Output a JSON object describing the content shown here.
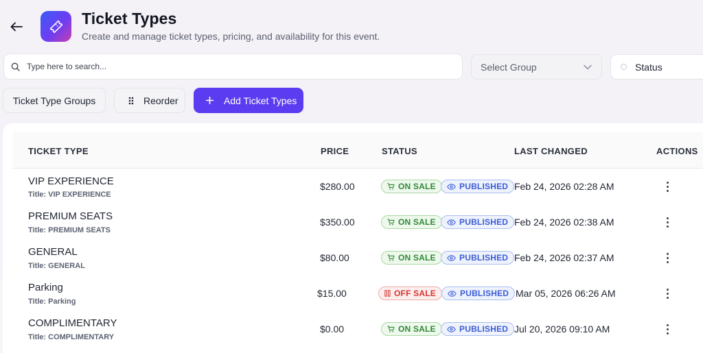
{
  "header": {
    "title": "Ticket Types",
    "subtitle": "Create and manage ticket types, pricing, and availability for this event."
  },
  "toolbar": {
    "search_placeholder": "Type here to search...",
    "group_select_label": "Select Group",
    "status_filter_label": "Status",
    "groups_button": "Ticket Type Groups",
    "reorder_button": "Reorder",
    "add_button": "Add Ticket Types"
  },
  "table": {
    "columns": [
      "TICKET TYPE",
      "PRICE",
      "STATUS",
      "LAST CHANGED",
      "ACTIONS"
    ],
    "rows": [
      {
        "name": "VIP EXPERIENCE",
        "title": "Title: VIP EXPERIENCE",
        "price": "$280.00",
        "sale": "ON SALE",
        "publish": "PUBLISHED",
        "changed": "Feb 24, 2026 02:28 AM"
      },
      {
        "name": "PREMIUM SEATS",
        "title": "Title: PREMIUM SEATS",
        "price": "$350.00",
        "sale": "ON SALE",
        "publish": "PUBLISHED",
        "changed": "Feb 24, 2026 02:38 AM"
      },
      {
        "name": "GENERAL",
        "title": "Title: GENERAL",
        "price": "$80.00",
        "sale": "ON SALE",
        "publish": "PUBLISHED",
        "changed": "Feb 24, 2026 02:37 AM"
      },
      {
        "name": "Parking",
        "title": "Title: Parking",
        "price": "$15.00",
        "sale": "OFF SALE",
        "publish": "PUBLISHED",
        "changed": "Mar 05, 2026 06:26 AM"
      },
      {
        "name": "COMPLIMENTARY",
        "title": "Title: COMPLIMENTARY",
        "price": "$0.00",
        "sale": "ON SALE",
        "publish": "PUBLISHED",
        "changed": "Jul 20, 2026 09:10 AM"
      }
    ]
  },
  "colors": {
    "accent": "#5b3cf0",
    "on_sale": "#2e8a36",
    "off_sale": "#d6342e",
    "published": "#3b5cd6"
  },
  "icons": [
    "back-arrow-icon",
    "ticket-icon",
    "search-icon",
    "chevron-down-icon",
    "status-circle-icon",
    "drag-grip-icon",
    "plus-icon",
    "cart-icon",
    "eye-icon",
    "kebab-menu-icon"
  ]
}
